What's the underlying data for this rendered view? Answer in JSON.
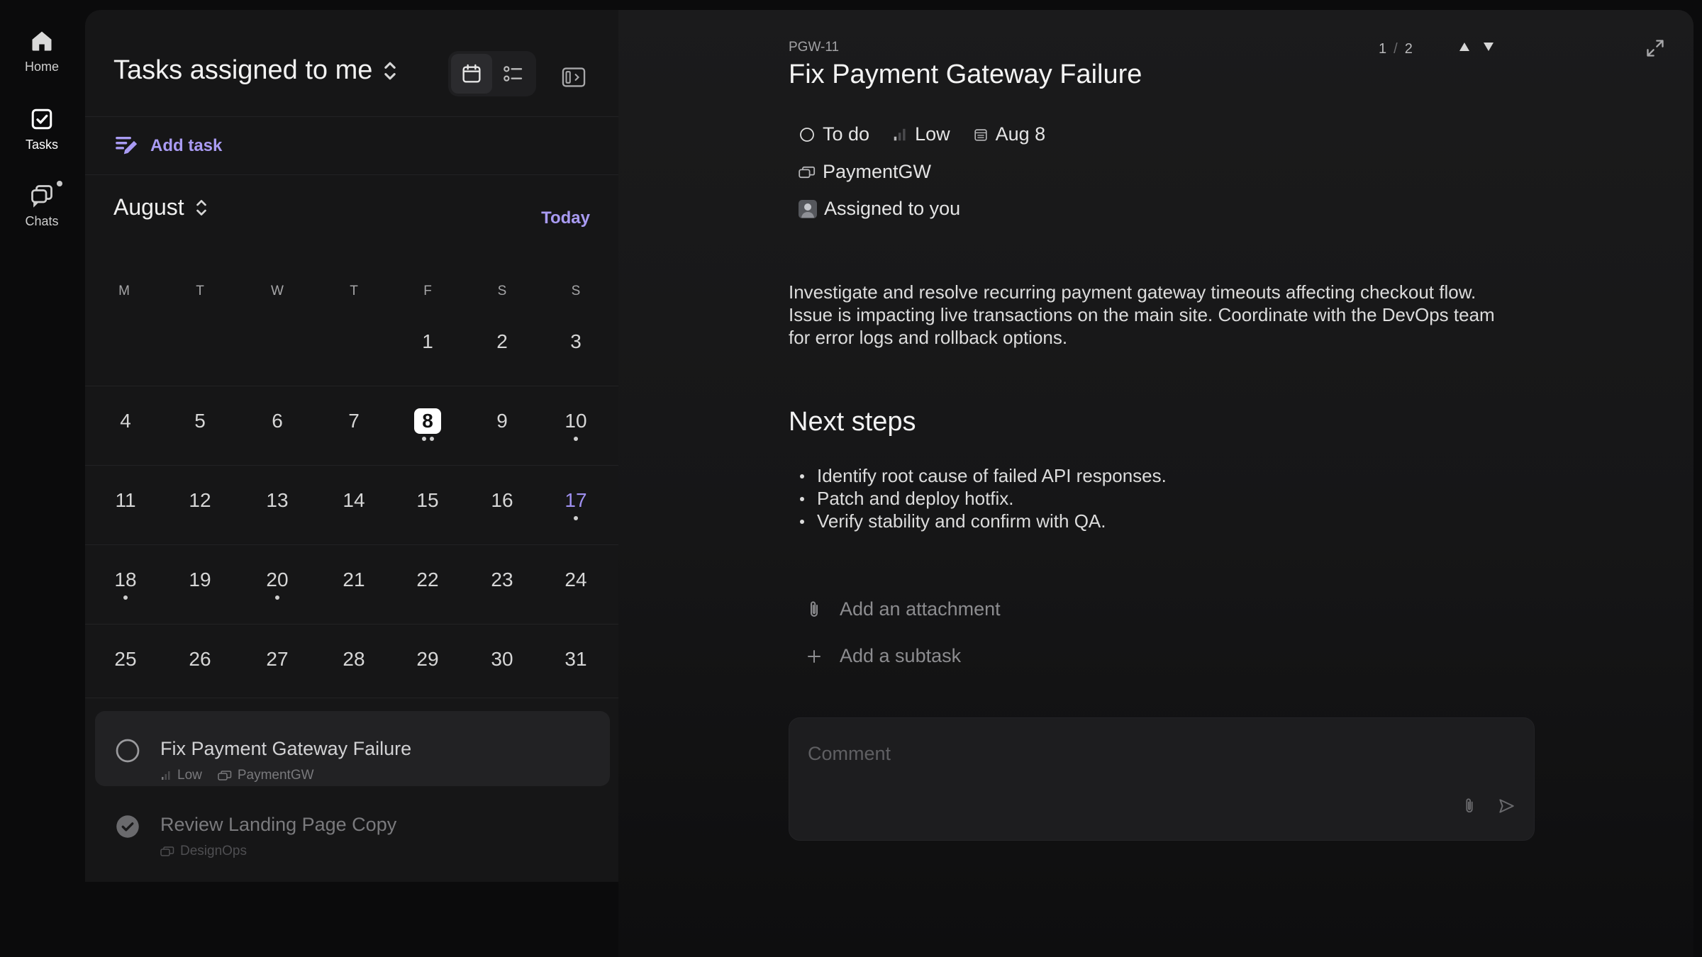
{
  "nav": {
    "items": [
      {
        "label": "Home",
        "icon": "home-icon"
      },
      {
        "label": "Tasks",
        "icon": "tasks-icon",
        "active": true
      },
      {
        "label": "Chats",
        "icon": "chats-icon",
        "has_notification": true
      }
    ]
  },
  "left": {
    "title": "Tasks assigned to me",
    "add_task_label": "Add task",
    "month": "August",
    "today_label": "Today",
    "weekdays": [
      "M",
      "T",
      "W",
      "T",
      "F",
      "S",
      "S"
    ],
    "weeks": [
      [
        null,
        null,
        null,
        null,
        "1",
        "2",
        "3"
      ],
      [
        "4",
        "5",
        "6",
        "7",
        "8",
        "9",
        "10"
      ],
      [
        "11",
        "12",
        "13",
        "14",
        "15",
        "16",
        "17"
      ],
      [
        "18",
        "19",
        "20",
        "21",
        "22",
        "23",
        "24"
      ],
      [
        "25",
        "26",
        "27",
        "28",
        "29",
        "30",
        "31"
      ]
    ],
    "selected_day": "8",
    "accent_day": "17",
    "day_dots": {
      "8": 2,
      "10": 1,
      "17": 1,
      "18": 1,
      "20": 1
    },
    "tasks": [
      {
        "title": "Fix Payment Gateway Failure",
        "priority": "Low",
        "project": "PaymentGW",
        "done": false,
        "active": true
      },
      {
        "title": "Review Landing Page Copy",
        "priority": "",
        "project": "DesignOps",
        "done": true,
        "active": false
      }
    ]
  },
  "detail": {
    "id": "PGW-11",
    "title": "Fix Payment Gateway Failure",
    "pager": {
      "current": "1",
      "separator": "/",
      "total": "2"
    },
    "status": "To do",
    "priority": "Low",
    "due": "Aug 8",
    "project": "PaymentGW",
    "assignee": "Assigned to you",
    "description": "Investigate and resolve recurring payment gateway timeouts affecting checkout flow. Issue is impacting live transactions on the main site. Coordinate with the DevOps team for error logs and rollback options.",
    "next_steps_heading": "Next steps",
    "next_steps": [
      "Identify root cause of failed API responses.",
      "Patch and deploy hotfix.",
      "Verify stability and confirm with QA."
    ],
    "add_attachment_label": "Add an attachment",
    "add_subtask_label": "Add a subtask",
    "comment_placeholder": "Comment"
  },
  "colors": {
    "accent": "#a99bf3",
    "background": "#0b0b0c",
    "panel": "#161617",
    "card": "#222224"
  }
}
